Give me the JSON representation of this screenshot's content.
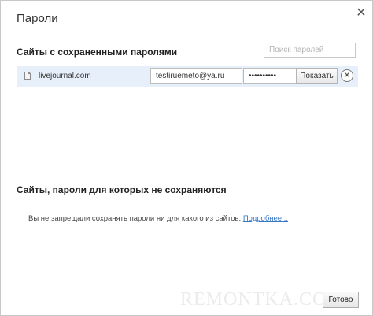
{
  "dialog": {
    "title": "Пароли",
    "close_icon": "close-icon"
  },
  "saved_section": {
    "title": "Сайты с сохраненными паролями",
    "search_placeholder": "Поиск паролей",
    "entries": [
      {
        "icon": "document-icon",
        "site": "livejournal.com",
        "login": "testiruemeto@ya.ru",
        "password_mask": "••••••••••",
        "show_label": "Показать",
        "remove_icon": "remove-circle-x-icon"
      }
    ]
  },
  "never_section": {
    "title": "Сайты, пароли для которых не сохраняются",
    "empty_text": "Вы не запрещали сохранять пароли ни для какого из сайтов.",
    "more_link": "Подробнее..."
  },
  "footer": {
    "done_label": "Готово",
    "watermark": "REMONTKA.COM"
  },
  "colors": {
    "row_highlight": "#e7f0fa",
    "link": "#3a77c8"
  }
}
